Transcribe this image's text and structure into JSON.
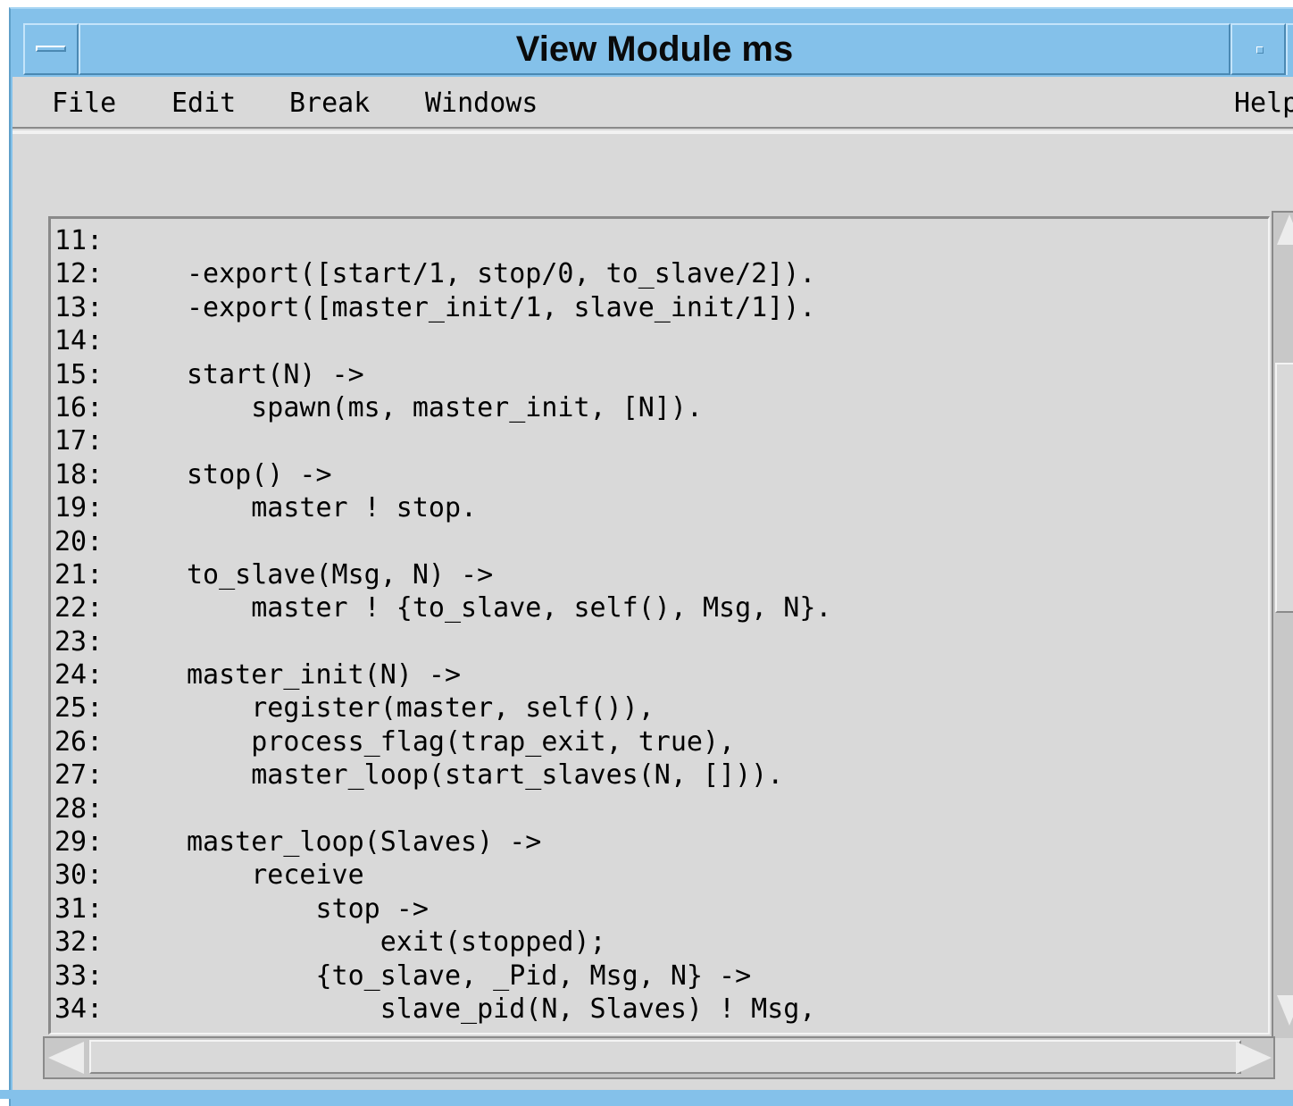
{
  "window": {
    "title": "View Module ms",
    "accent_color": "#84c1ea",
    "background_color": "#d9d9d9"
  },
  "titlebar_icons": {
    "menu": "window-menu-icon",
    "minimize": "minimize-icon",
    "maximize": "maximize-icon"
  },
  "menubar": {
    "file": "File",
    "edit": "Edit",
    "break": "Break",
    "windows": "Windows",
    "help": "Help"
  },
  "code": {
    "lines": [
      {
        "num": "11:",
        "text": ""
      },
      {
        "num": "12:",
        "text": "-export([start/1, stop/0, to_slave/2])."
      },
      {
        "num": "13:",
        "text": "-export([master_init/1, slave_init/1])."
      },
      {
        "num": "14:",
        "text": ""
      },
      {
        "num": "15:",
        "text": "start(N) ->"
      },
      {
        "num": "16:",
        "text": "    spawn(ms, master_init, [N])."
      },
      {
        "num": "17:",
        "text": ""
      },
      {
        "num": "18:",
        "text": "stop() ->"
      },
      {
        "num": "19:",
        "text": "    master ! stop."
      },
      {
        "num": "20:",
        "text": ""
      },
      {
        "num": "21:",
        "text": "to_slave(Msg, N) ->"
      },
      {
        "num": "22:",
        "text": "    master ! {to_slave, self(), Msg, N}."
      },
      {
        "num": "23:",
        "text": ""
      },
      {
        "num": "24:",
        "text": "master_init(N) ->"
      },
      {
        "num": "25:",
        "text": "    register(master, self()),"
      },
      {
        "num": "26:",
        "text": "    process_flag(trap_exit, true),"
      },
      {
        "num": "27:",
        "text": "    master_loop(start_slaves(N, []))."
      },
      {
        "num": "28:",
        "text": ""
      },
      {
        "num": "29:",
        "text": "master_loop(Slaves) ->"
      },
      {
        "num": "30:",
        "text": "    receive"
      },
      {
        "num": "31:",
        "text": "        stop ->"
      },
      {
        "num": "32:",
        "text": "            exit(stopped);"
      },
      {
        "num": "33:",
        "text": "        {to_slave, _Pid, Msg, N} ->"
      },
      {
        "num": "34:",
        "text": "            slave_pid(N, Slaves) ! Msg,"
      }
    ]
  },
  "scrollbars": {
    "vertical_up": "arrow-up-icon",
    "vertical_down": "arrow-down-icon",
    "horizontal_left": "arrow-left-icon",
    "horizontal_right": "arrow-right-icon"
  }
}
